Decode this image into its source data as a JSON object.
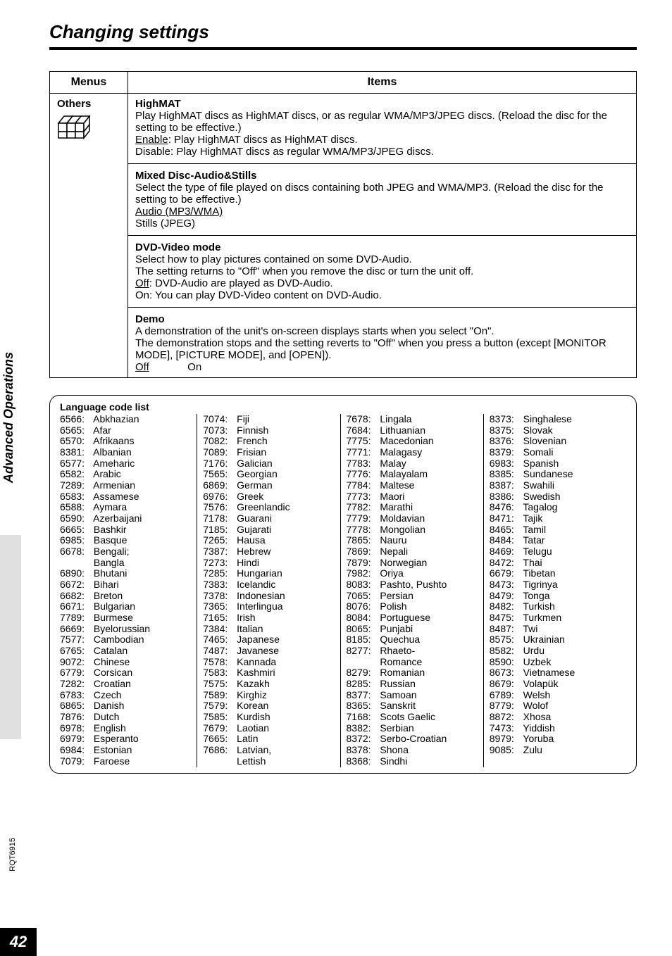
{
  "heading": "Changing settings",
  "table": {
    "hdr_menus": "Menus",
    "hdr_items": "Items",
    "menus_label": "Others"
  },
  "highmat": {
    "title": "HighMAT",
    "desc": "Play HighMAT discs as HighMAT discs, or as regular WMA/MP3/JPEG discs. (Reload the disc for the setting to be effective.)",
    "enable_label": "Enable",
    "enable_text": ":   Play HighMAT discs as HighMAT discs.",
    "disable_text": "Disable:  Play HighMAT discs as regular WMA/MP3/JPEG discs."
  },
  "mixed": {
    "title": "Mixed Disc-Audio&Stills",
    "desc": "Select the type of file played on discs containing both JPEG and WMA/MP3. (Reload the disc for the setting to be effective.)",
    "opt1": "Audio (MP3/WMA)",
    "opt2": "Stills (JPEG)"
  },
  "dvd": {
    "title": "DVD-Video mode",
    "l1": "Select how to play pictures contained on some DVD-Audio.",
    "l2": "The setting returns to \"Off\" when you remove the disc or turn the unit off.",
    "off_label": "Off",
    "off_text": ":  DVD-Audio are played as DVD-Audio.",
    "on_text": "On:  You can play DVD-Video content on DVD-Audio."
  },
  "demo": {
    "title": "Demo",
    "l1": "A demonstration of the unit's on-screen displays starts when you select \"On\".",
    "l2": "The demonstration stops and the setting reverts to \"Off\" when you press a button (except [MONITOR MODE], [PICTURE MODE], and [OPEN]).",
    "off": "Off",
    "on": "On"
  },
  "lang": {
    "title": "Language code list",
    "cols": [
      [
        {
          "c": "6566",
          "n": "Abkhazian"
        },
        {
          "c": "6565",
          "n": "Afar"
        },
        {
          "c": "6570",
          "n": "Afrikaans"
        },
        {
          "c": "8381",
          "n": "Albanian"
        },
        {
          "c": "6577",
          "n": "Ameharic"
        },
        {
          "c": "6582",
          "n": "Arabic"
        },
        {
          "c": "7289",
          "n": "Armenian"
        },
        {
          "c": "6583",
          "n": "Assamese"
        },
        {
          "c": "6588",
          "n": "Aymara"
        },
        {
          "c": "6590",
          "n": "Azerbaijani"
        },
        {
          "c": "6665",
          "n": "Bashkir"
        },
        {
          "c": "6985",
          "n": "Basque"
        },
        {
          "c": "6678",
          "n": "Bengali;"
        },
        {
          "c": "",
          "n": "Bangla"
        },
        {
          "c": "6890",
          "n": "Bhutani"
        },
        {
          "c": "6672",
          "n": "Bihari"
        },
        {
          "c": "6682",
          "n": "Breton"
        },
        {
          "c": "6671",
          "n": "Bulgarian"
        },
        {
          "c": "7789",
          "n": "Burmese"
        },
        {
          "c": "6669",
          "n": "Byelorussian"
        },
        {
          "c": "7577",
          "n": "Cambodian"
        },
        {
          "c": "6765",
          "n": "Catalan"
        },
        {
          "c": "9072",
          "n": "Chinese"
        },
        {
          "c": "6779",
          "n": "Corsican"
        },
        {
          "c": "7282",
          "n": "Croatian"
        },
        {
          "c": "6783",
          "n": "Czech"
        },
        {
          "c": "6865",
          "n": "Danish"
        },
        {
          "c": "7876",
          "n": "Dutch"
        },
        {
          "c": "6978",
          "n": "English"
        },
        {
          "c": "6979",
          "n": "Esperanto"
        },
        {
          "c": "6984",
          "n": "Estonian"
        },
        {
          "c": "7079",
          "n": "Faroese"
        }
      ],
      [
        {
          "c": "7074",
          "n": "Fiji"
        },
        {
          "c": "7073",
          "n": "Finnish"
        },
        {
          "c": "7082",
          "n": "French"
        },
        {
          "c": "7089",
          "n": "Frisian"
        },
        {
          "c": "7176",
          "n": "Galician"
        },
        {
          "c": "7565",
          "n": "Georgian"
        },
        {
          "c": "6869",
          "n": "German"
        },
        {
          "c": "6976",
          "n": "Greek"
        },
        {
          "c": "7576",
          "n": "Greenlandic"
        },
        {
          "c": "7178",
          "n": "Guarani"
        },
        {
          "c": "7185",
          "n": "Gujarati"
        },
        {
          "c": "7265",
          "n": "Hausa"
        },
        {
          "c": "7387",
          "n": "Hebrew"
        },
        {
          "c": "7273",
          "n": "Hindi"
        },
        {
          "c": "7285",
          "n": "Hungarian"
        },
        {
          "c": "7383",
          "n": "Icelandic"
        },
        {
          "c": "7378",
          "n": "Indonesian"
        },
        {
          "c": "7365",
          "n": "Interlingua"
        },
        {
          "c": "7165",
          "n": "Irish"
        },
        {
          "c": "7384",
          "n": "Italian"
        },
        {
          "c": "7465",
          "n": "Japanese"
        },
        {
          "c": "7487",
          "n": "Javanese"
        },
        {
          "c": "7578",
          "n": "Kannada"
        },
        {
          "c": "7583",
          "n": "Kashmiri"
        },
        {
          "c": "7575",
          "n": "Kazakh"
        },
        {
          "c": "7589",
          "n": "Kirghiz"
        },
        {
          "c": "7579",
          "n": "Korean"
        },
        {
          "c": "7585",
          "n": "Kurdish"
        },
        {
          "c": "7679",
          "n": "Laotian"
        },
        {
          "c": "7665",
          "n": "Latin"
        },
        {
          "c": "7686",
          "n": "Latvian,"
        },
        {
          "c": "",
          "n": "Lettish"
        }
      ],
      [
        {
          "c": "7678",
          "n": "Lingala"
        },
        {
          "c": "7684",
          "n": "Lithuanian"
        },
        {
          "c": "7775",
          "n": "Macedonian"
        },
        {
          "c": "7771",
          "n": "Malagasy"
        },
        {
          "c": "7783",
          "n": "Malay"
        },
        {
          "c": "7776",
          "n": "Malayalam"
        },
        {
          "c": "7784",
          "n": "Maltese"
        },
        {
          "c": "7773",
          "n": "Maori"
        },
        {
          "c": "7782",
          "n": "Marathi"
        },
        {
          "c": "7779",
          "n": "Moldavian"
        },
        {
          "c": "7778",
          "n": "Mongolian"
        },
        {
          "c": "7865",
          "n": "Nauru"
        },
        {
          "c": "7869",
          "n": "Nepali"
        },
        {
          "c": "7879",
          "n": "Norwegian"
        },
        {
          "c": "7982",
          "n": "Oriya"
        },
        {
          "c": "8083",
          "n": "Pashto, Pushto"
        },
        {
          "c": "7065",
          "n": "Persian"
        },
        {
          "c": "8076",
          "n": "Polish"
        },
        {
          "c": "8084",
          "n": "Portuguese"
        },
        {
          "c": "8065",
          "n": "Punjabi"
        },
        {
          "c": "8185",
          "n": "Quechua"
        },
        {
          "c": "8277",
          "n": "Rhaeto-"
        },
        {
          "c": "",
          "n": "Romance"
        },
        {
          "c": "8279",
          "n": "Romanian"
        },
        {
          "c": "8285",
          "n": "Russian"
        },
        {
          "c": "8377",
          "n": "Samoan"
        },
        {
          "c": "8365",
          "n": "Sanskrit"
        },
        {
          "c": "7168",
          "n": "Scots Gaelic"
        },
        {
          "c": "8382",
          "n": "Serbian"
        },
        {
          "c": "8372",
          "n": "Serbo-Croatian"
        },
        {
          "c": "8378",
          "n": "Shona"
        },
        {
          "c": "8368",
          "n": "Sindhi"
        }
      ],
      [
        {
          "c": "8373",
          "n": "Singhalese"
        },
        {
          "c": "8375",
          "n": "Slovak"
        },
        {
          "c": "8376",
          "n": "Slovenian"
        },
        {
          "c": "8379",
          "n": "Somali"
        },
        {
          "c": "6983",
          "n": "Spanish"
        },
        {
          "c": "8385",
          "n": "Sundanese"
        },
        {
          "c": "8387",
          "n": "Swahili"
        },
        {
          "c": "8386",
          "n": "Swedish"
        },
        {
          "c": "8476",
          "n": "Tagalog"
        },
        {
          "c": "8471",
          "n": "Tajik"
        },
        {
          "c": "8465",
          "n": "Tamil"
        },
        {
          "c": "8484",
          "n": "Tatar"
        },
        {
          "c": "8469",
          "n": "Telugu"
        },
        {
          "c": "8472",
          "n": "Thai"
        },
        {
          "c": "6679",
          "n": "Tibetan"
        },
        {
          "c": "8473",
          "n": "Tigrinya"
        },
        {
          "c": "8479",
          "n": "Tonga"
        },
        {
          "c": "8482",
          "n": "Turkish"
        },
        {
          "c": "8475",
          "n": "Turkmen"
        },
        {
          "c": "8487",
          "n": "Twi"
        },
        {
          "c": "8575",
          "n": "Ukrainian"
        },
        {
          "c": "8582",
          "n": "Urdu"
        },
        {
          "c": "8590",
          "n": "Uzbek"
        },
        {
          "c": "8673",
          "n": "Vietnamese"
        },
        {
          "c": "8679",
          "n": "Volapük"
        },
        {
          "c": "6789",
          "n": "Welsh"
        },
        {
          "c": "8779",
          "n": "Wolof"
        },
        {
          "c": "8872",
          "n": "Xhosa"
        },
        {
          "c": "7473",
          "n": "Yiddish"
        },
        {
          "c": "8979",
          "n": "Yoruba"
        },
        {
          "c": "9085",
          "n": "Zulu"
        }
      ]
    ]
  },
  "side_section": "Advanced Operations",
  "side_code": "RQT6915",
  "page_num": "42"
}
